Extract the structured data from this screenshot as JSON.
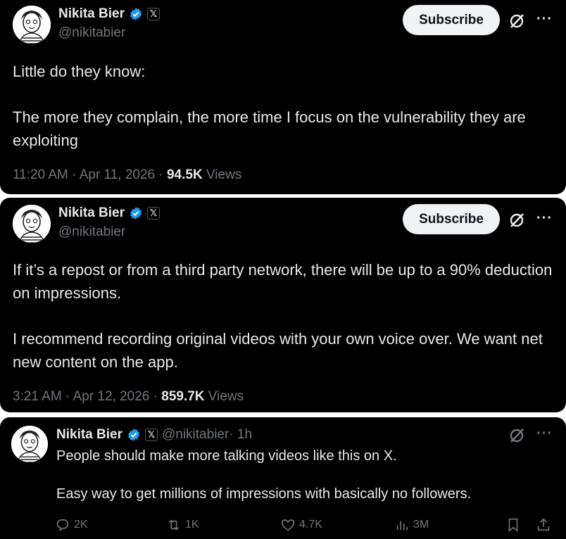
{
  "posts": [
    {
      "author": {
        "name": "Nikita Bier",
        "handle": "@nikitabier"
      },
      "badge": "𝕏",
      "subscribe_label": "Subscribe",
      "body": [
        "Little do they know:",
        "The more they complain, the more time I focus on the vulnerability they are exploiting"
      ],
      "timestamp": "11:20 AM · Apr 11, 2026 · ",
      "views_count": "94.5K",
      "views_label": " Views"
    },
    {
      "author": {
        "name": "Nikita Bier",
        "handle": "@nikitabier"
      },
      "badge": "𝕏",
      "subscribe_label": "Subscribe",
      "body": [
        "If it’s a repost or from a third party network, there will be up to a 90% deduction on impressions.",
        "I recommend recording original videos with your own voice over. We want net new content on the app."
      ],
      "timestamp": "3:21 AM · Apr 12, 2026 · ",
      "views_count": "859.7K",
      "views_label": " Views"
    },
    {
      "author": {
        "name": "Nikita Bier",
        "handle": "@nikitabier"
      },
      "badge": "𝕏",
      "age": " · 1h",
      "body": [
        "People should make more talking videos like this on X.",
        "Easy way to get millions of impressions with basically no followers."
      ],
      "actions": {
        "replies": "2K",
        "reposts": "1K",
        "likes": "4.7K",
        "views": "3M"
      }
    }
  ],
  "colors": {
    "background": "#000000",
    "text": "#e7e9ea",
    "muted": "#71767b",
    "verified": "#1d9bf0",
    "button": "#eff3f4"
  },
  "icons": [
    "verified-badge-icon",
    "x-logo-icon",
    "grok-icon",
    "more-icon",
    "reply-icon",
    "repost-icon",
    "like-icon",
    "views-icon",
    "bookmark-icon",
    "share-icon"
  ]
}
